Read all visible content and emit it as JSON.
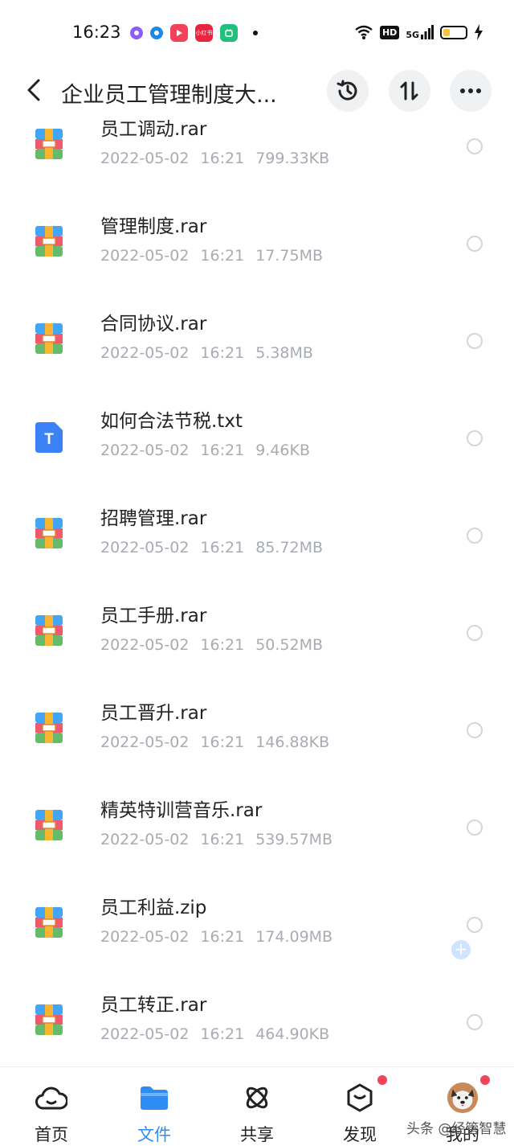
{
  "status_bar": {
    "time": "16:23",
    "mini_app_label": "小红书",
    "icons": [
      "purple-ring-icon",
      "blue-ring-icon",
      "video-app-icon",
      "red-app-icon",
      "green-app-icon",
      "wifi-icon",
      "hd-icon",
      "5g-signal-icon",
      "battery-icon",
      "charging-icon"
    ],
    "hd": "HD",
    "network": "5G",
    "battery_level": 0.3
  },
  "header": {
    "title": "企业员工管理制度大...",
    "icons": [
      "back-arrow-icon",
      "history-icon",
      "sort-icon",
      "more-icon"
    ]
  },
  "files": [
    {
      "name": "员工调动.rar",
      "date": "2022-05-02",
      "time": "16:21",
      "size": "799.33KB",
      "type": "archive"
    },
    {
      "name": "管理制度.rar",
      "date": "2022-05-02",
      "time": "16:21",
      "size": "17.75MB",
      "type": "archive"
    },
    {
      "name": "合同协议.rar",
      "date": "2022-05-02",
      "time": "16:21",
      "size": "5.38MB",
      "type": "archive"
    },
    {
      "name": "如何合法节税.txt",
      "date": "2022-05-02",
      "time": "16:21",
      "size": "9.46KB",
      "type": "text",
      "icon_letter": "T"
    },
    {
      "name": "招聘管理.rar",
      "date": "2022-05-02",
      "time": "16:21",
      "size": "85.72MB",
      "type": "archive"
    },
    {
      "name": "员工手册.rar",
      "date": "2022-05-02",
      "time": "16:21",
      "size": "50.52MB",
      "type": "archive"
    },
    {
      "name": "员工晋升.rar",
      "date": "2022-05-02",
      "time": "16:21",
      "size": "146.88KB",
      "type": "archive"
    },
    {
      "name": "精英特训营音乐.rar",
      "date": "2022-05-02",
      "time": "16:21",
      "size": "539.57MB",
      "type": "archive"
    },
    {
      "name": "员工利益.zip",
      "date": "2022-05-02",
      "time": "16:21",
      "size": "174.09MB",
      "type": "archive"
    },
    {
      "name": "员工转正.rar",
      "date": "2022-05-02",
      "time": "16:21",
      "size": "464.90KB",
      "type": "archive"
    }
  ],
  "floating_button": "+",
  "bottom_nav": [
    {
      "label": "首页",
      "icon": "cloud-home-icon",
      "active": false
    },
    {
      "label": "文件",
      "icon": "folder-icon",
      "active": true
    },
    {
      "label": "共享",
      "icon": "share-atom-icon",
      "active": false
    },
    {
      "label": "发现",
      "icon": "discover-box-icon",
      "active": false
    },
    {
      "label": "我的",
      "icon": "avatar-icon",
      "active": false
    }
  ],
  "watermark": "头条 @经管智慧",
  "colors": {
    "accent": "#2f8cf5",
    "meta_text": "#a8acb2",
    "badge_red": "#f0465a"
  }
}
